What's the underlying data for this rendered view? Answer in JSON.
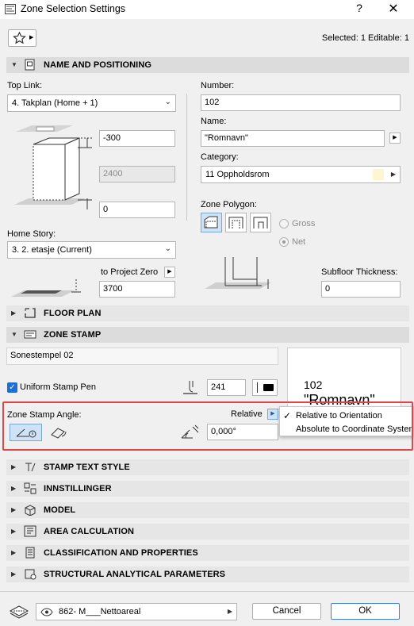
{
  "window": {
    "title": "Zone Selection Settings",
    "help_label": "?",
    "close_label": "✕"
  },
  "header": {
    "selection_info": "Selected: 1 Editable: 1"
  },
  "sections": {
    "name_positioning": "NAME AND POSITIONING",
    "floor_plan": "FLOOR PLAN",
    "zone_stamp": "ZONE STAMP",
    "stamp_text_style": "STAMP TEXT STYLE",
    "innstillinger": "INNSTILLINGER",
    "model": "MODEL",
    "area_calculation": "AREA CALCULATION",
    "classification": "CLASSIFICATION AND PROPERTIES",
    "structural": "STRUCTURAL ANALYTICAL PARAMETERS"
  },
  "positioning": {
    "top_link_label": "Top Link:",
    "top_link_value": "4. Takplan (Home + 1)",
    "top_offset": "-300",
    "height": "2400",
    "bottom_offset": "0",
    "home_story_label": "Home Story:",
    "home_story_value": "3. 2. etasje (Current)",
    "to_project_zero_label": "to Project Zero",
    "to_project_zero_value": "3700",
    "number_label": "Number:",
    "number_value": "102",
    "name_label": "Name:",
    "name_value": "\"Romnavn\"",
    "category_label": "Category:",
    "category_value": "11  Oppholdsrom",
    "zone_polygon_label": "Zone Polygon:",
    "gross_label": "Gross",
    "net_label": "Net",
    "subfloor_label": "Subfloor Thickness:",
    "subfloor_value": "0"
  },
  "zone_stamp": {
    "stamp_name": "Sonestempel 02",
    "uniform_pen_label": "Uniform Stamp Pen",
    "pen_value": "241",
    "angle_label": "Zone Stamp Angle:",
    "relative_label": "Relative",
    "angle_value": "0,000°",
    "preview_number": "102",
    "preview_name": "\"Romnavn\"",
    "menu_items": [
      "Relative to Orientation",
      "Absolute to Coordinate System"
    ],
    "menu_checked": "✓"
  },
  "footer": {
    "layer_value": "862- M___Nettoareal",
    "cancel_label": "Cancel",
    "ok_label": "OK"
  },
  "colors": {
    "accent": "#1e6fd0",
    "highlight": "#e0454a"
  }
}
